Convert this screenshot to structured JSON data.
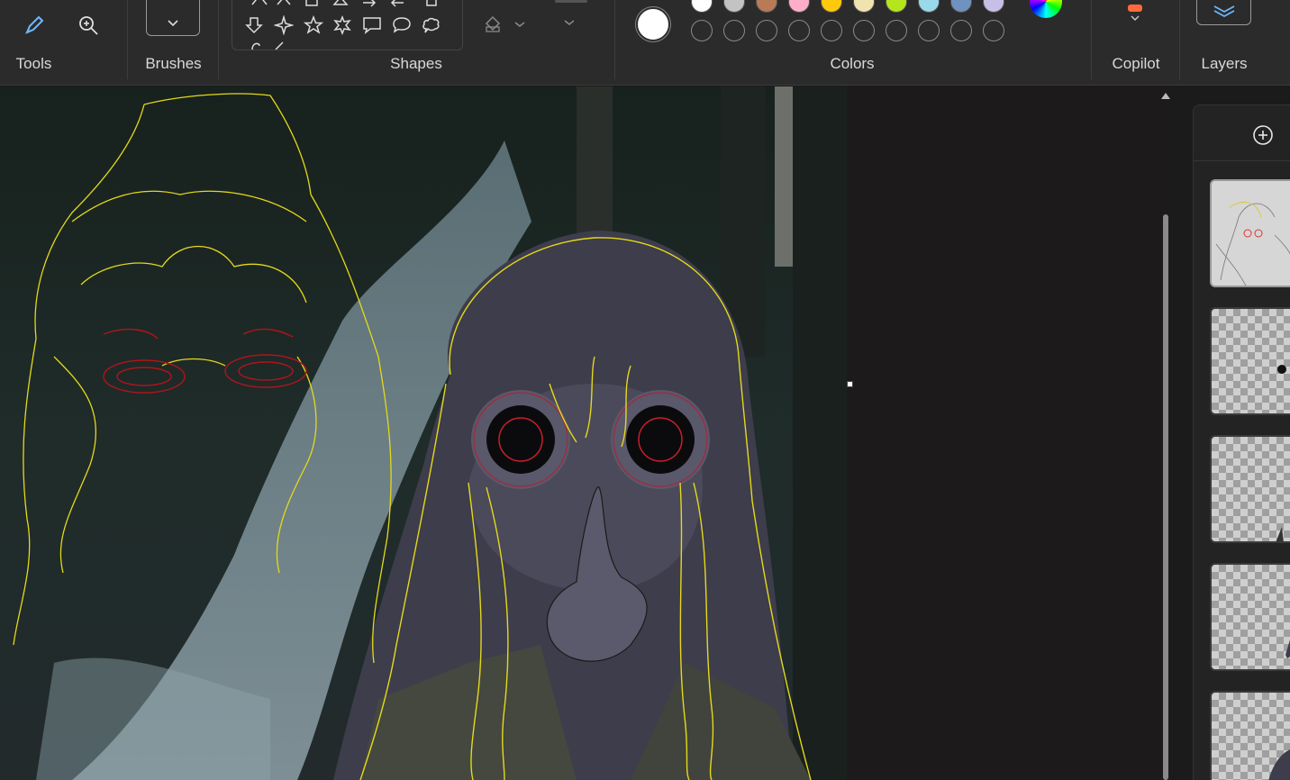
{
  "ribbon": {
    "groups": {
      "tools": "Tools",
      "brushes": "Brushes",
      "shapes": "Shapes",
      "colors": "Colors",
      "copilot": "Copilot",
      "layers": "Layers"
    },
    "tool_icons": [
      "pen-icon",
      "zoom-in-icon"
    ],
    "shape_icons": [
      "arrow-down-icon",
      "star4-icon",
      "star5-icon",
      "star6-icon",
      "speech-rect-icon",
      "speech-oval-icon",
      "speech-cloud-icon"
    ],
    "current_color": "#ffffff",
    "palette_row1": [
      "#ffffff",
      "#c3c3c3",
      "#b97a57",
      "#ffaec9",
      "#ffc90e",
      "#efe4b0",
      "#b5e61d",
      "#99d9ea",
      "#7092be",
      "#c8bfe7"
    ],
    "palette_row2_count": 10,
    "accent": "#0078d4"
  },
  "canvas": {
    "background": "forest stream"
  },
  "layers_panel": {
    "add_layer_icon": "add-circle-icon",
    "layer_count": 5
  }
}
